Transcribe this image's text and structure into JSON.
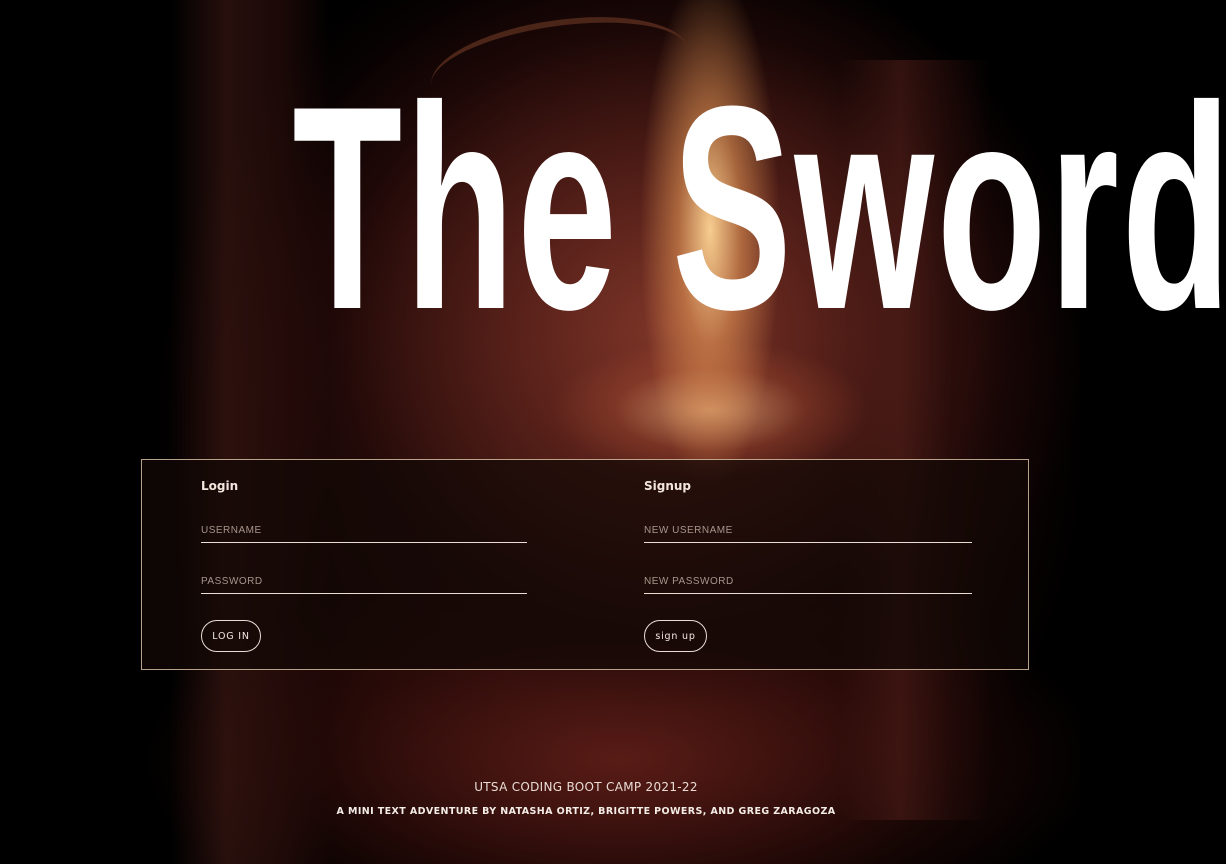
{
  "title": "The Sword",
  "login": {
    "heading": "Login",
    "username_placeholder": "USERNAME",
    "password_placeholder": "PASSWORD",
    "button_label": "LOG IN"
  },
  "signup": {
    "heading": "Signup",
    "username_placeholder": "NEW USERNAME",
    "password_placeholder": "NEW PASSWORD",
    "button_label": "sign up"
  },
  "footer": {
    "line1": "UTSA CODING BOOT CAMP 2021-22",
    "line2": "A MINI TEXT ADVENTURE BY NATASHA ORTIZ, BRIGITTE POWERS, AND GREG ZARAGOZA"
  },
  "colors": {
    "background": "#000000",
    "title": "#ffffff",
    "panel_border": "#e1c8aa",
    "text": "#f2e6de"
  }
}
